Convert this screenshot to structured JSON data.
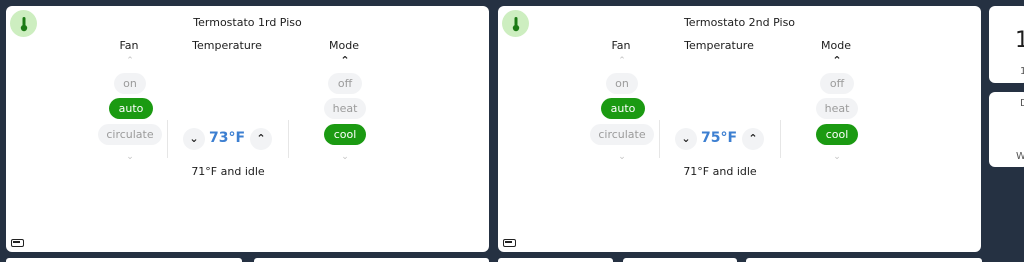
{
  "thermostats": [
    {
      "title": "Termostato 1rd Piso",
      "icon": "thermometer-icon",
      "fan_label": "Fan",
      "temperature_label": "Temperature",
      "mode_label": "Mode",
      "fan_options": [
        "on",
        "auto",
        "circulate"
      ],
      "fan_selected": "auto",
      "mode_options": [
        "off",
        "heat",
        "cool"
      ],
      "mode_selected": "cool",
      "target_temp": "73°F",
      "status": "71°F and idle"
    },
    {
      "title": "Termostato 2nd Piso",
      "icon": "thermometer-icon",
      "fan_label": "Fan",
      "temperature_label": "Temperature",
      "mode_label": "Mode",
      "fan_options": [
        "on",
        "auto",
        "circulate"
      ],
      "fan_selected": "auto",
      "mode_options": [
        "off",
        "heat",
        "cool"
      ],
      "mode_selected": "cool",
      "target_temp": "75°F",
      "status": "71°F and idle"
    }
  ],
  "side_cards": {
    "card1_big": "1",
    "card1_small": "1",
    "card2_top": "D",
    "card2_bottom": "W"
  },
  "colors": {
    "background": "#253142",
    "active_green": "#1b9a12",
    "temp_blue": "#3c7fd1",
    "thermo_badge": "#cdeec0"
  }
}
